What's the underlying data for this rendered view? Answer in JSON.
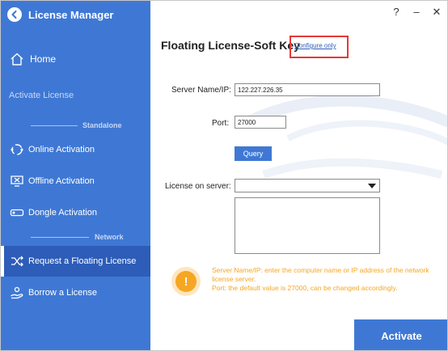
{
  "app": {
    "title": "License Manager"
  },
  "window_controls": {
    "help": "?",
    "minimize": "–",
    "close": "✕"
  },
  "sidebar": {
    "home_label": "Home",
    "activate_section_label": "Activate License",
    "standalone_label": "Standalone",
    "network_label": "Network",
    "items": [
      {
        "label": "Online Activation",
        "icon": "cloud-sync-icon"
      },
      {
        "label": "Offline Activation",
        "icon": "offline-monitor-icon"
      },
      {
        "label": "Dongle Activation",
        "icon": "usb-dongle-icon"
      },
      {
        "label": "Request a Floating License",
        "icon": "shuffle-icon",
        "active": true
      },
      {
        "label": "Borrow a License",
        "icon": "hand-key-icon"
      }
    ]
  },
  "main": {
    "title": "Floating License-Soft Key",
    "configure_link": "Configure only",
    "server_label": "Server Name/IP:",
    "server_value": "122.227.226.35",
    "port_label": "Port:",
    "port_value": "27000",
    "query_label": "Query",
    "license_on_server_label": "License on server:",
    "license_on_server_value": "",
    "hint_icon": "!",
    "hint_line1": "Server Name/IP: enter the computer name or IP address of the network license server.",
    "hint_line2": "Port: the default value is 27000, can be changed accordingly.",
    "activate_label": "Activate"
  },
  "colors": {
    "sidebar": "#3f78d4",
    "sidebar_active": "#2d5db8",
    "accent": "#3f78d4",
    "hint": "#f5a623",
    "highlight_box": "#e53935"
  }
}
